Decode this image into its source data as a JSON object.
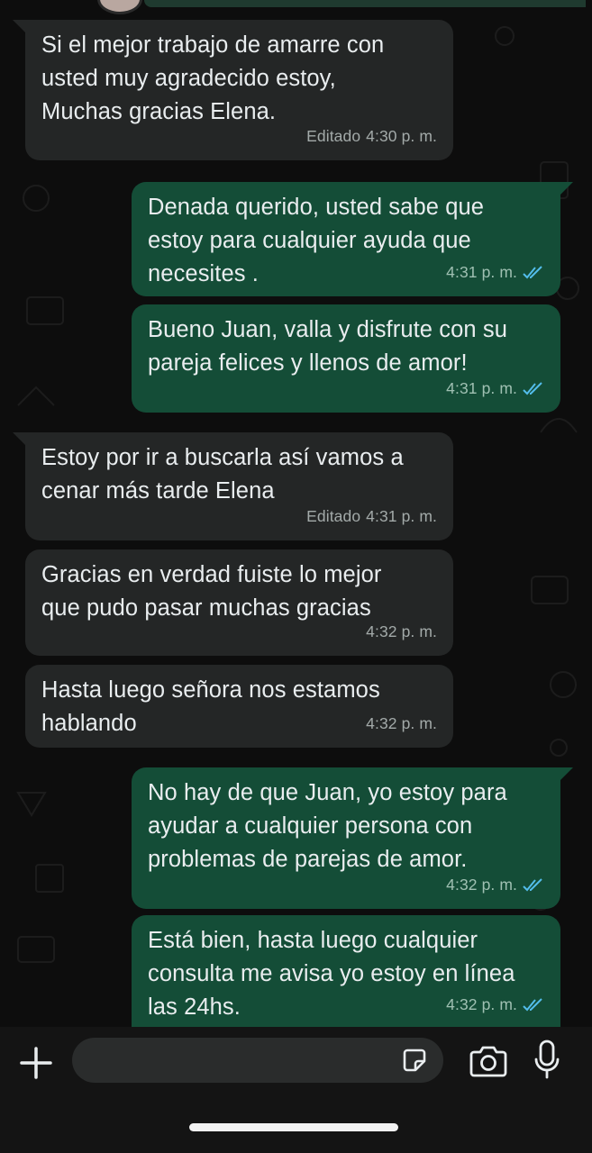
{
  "colors": {
    "incoming_bubble": "#242626",
    "outgoing_bubble": "#144d37",
    "read_ticks": "#53bdeb",
    "text": "#e9edef"
  },
  "messages": [
    {
      "direction": "incoming",
      "text": "Si el mejor trabajo de amarre con\nusted muy agradecido estoy,\nMuchas gracias Elena.",
      "edited_label": "Editado",
      "time": "4:30 p. m."
    },
    {
      "direction": "outgoing",
      "text": "Denada querido, usted sabe que\nestoy para cualquier ayuda que\nnecesites .",
      "time": "4:31 p. m.",
      "status_icon": "double-check-read-icon"
    },
    {
      "direction": "outgoing",
      "text": "Bueno Juan, valla y disfrute con su\npareja felices y llenos de amor!",
      "time": "4:31 p. m.",
      "status_icon": "double-check-read-icon"
    },
    {
      "direction": "incoming",
      "text": "Estoy por ir a buscarla así vamos a\ncenar más tarde Elena",
      "edited_label": "Editado",
      "time": "4:31 p. m."
    },
    {
      "direction": "incoming",
      "text": "Gracias en verdad fuiste lo mejor\nque pudo pasar muchas gracias",
      "time": "4:32 p. m."
    },
    {
      "direction": "incoming",
      "text": "Hasta luego señora nos estamos\nhablando",
      "time": "4:32 p. m."
    },
    {
      "direction": "outgoing",
      "text": "No hay de que Juan, yo estoy para\nayudar a cualquier persona con\nproblemas de parejas de amor.",
      "time": "4:32 p. m.",
      "status_icon": "double-check-read-icon"
    },
    {
      "direction": "outgoing",
      "text": "Está bien, hasta luego cualquier\nconsulta me avisa yo estoy en línea\nlas 24hs.",
      "time": "4:32 p. m.",
      "status_icon": "double-check-read-icon"
    }
  ],
  "composer": {
    "placeholder": "",
    "icons": [
      "plus-icon",
      "sticker-icon",
      "camera-icon",
      "microphone-icon"
    ]
  }
}
